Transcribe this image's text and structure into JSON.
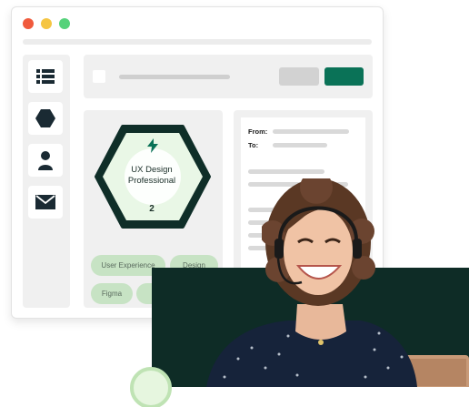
{
  "window": {
    "controls": {
      "close_color": "#f05a3c",
      "minimize_color": "#f5c542",
      "maximize_color": "#55d27a"
    }
  },
  "sidebar": {
    "items": [
      {
        "icon": "list-icon"
      },
      {
        "icon": "hexagon-icon"
      },
      {
        "icon": "person-icon"
      },
      {
        "icon": "mail-icon"
      }
    ]
  },
  "badge": {
    "title": "UX Design Professional",
    "level": "2",
    "icon": "lightning-icon",
    "border_color": "#0f2e28",
    "fill_color": "#e9f7e6"
  },
  "skills": [
    "User Experience",
    "Design",
    "Figma"
  ],
  "message": {
    "from_label": "From:",
    "to_label": "To:"
  },
  "colors": {
    "accent": "#0a7257",
    "pill": "#c7e3c4",
    "photo_bg": "#0e2c26"
  },
  "photo": {
    "subject": "smiling-woman-with-headset"
  }
}
